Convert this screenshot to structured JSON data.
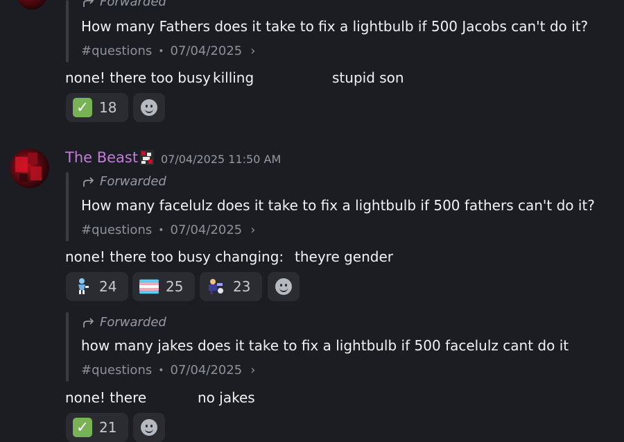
{
  "messages": [
    {
      "forwarded_label": "Forwarded",
      "text": "How many Fathers does it take to fix a lightbulb if 500 Jacobs can't do it?",
      "channel": "#questions",
      "date": "07/04/2025",
      "reply_parts": [
        "none! there too busy",
        "killing",
        "stupid son"
      ],
      "reactions": [
        {
          "emoji": "check-mark",
          "count": "18"
        }
      ]
    },
    {
      "author": "The Beast",
      "timestamp": "07/04/2025 11:50 AM",
      "forwarded_label": "Forwarded",
      "text": "How many facelulz does it take to fix a lightbulb if 500 fathers can't do it?",
      "channel": "#questions",
      "date": "07/04/2025",
      "reply_parts": [
        "none! there too busy changing:",
        "theyre gender"
      ],
      "reactions": [
        {
          "emoji": "figure-emoji",
          "count": "24"
        },
        {
          "emoji": "trans-flag",
          "count": "25"
        },
        {
          "emoji": "character-emoji",
          "count": "23"
        }
      ]
    },
    {
      "forwarded_label": "Forwarded",
      "text": "how many jakes does it take to fix a lightbulb if 500 facelulz cant do it",
      "channel": "#questions",
      "date": "07/04/2025",
      "reply_parts": [
        "none! there",
        "no jakes"
      ],
      "reactions": [
        {
          "emoji": "check-mark",
          "count": "21"
        }
      ]
    }
  ],
  "colors": {
    "background": "#1c1d22",
    "username": "#c27dd8",
    "reaction_bg": "#2a2c32",
    "check_green": "#77b255"
  }
}
